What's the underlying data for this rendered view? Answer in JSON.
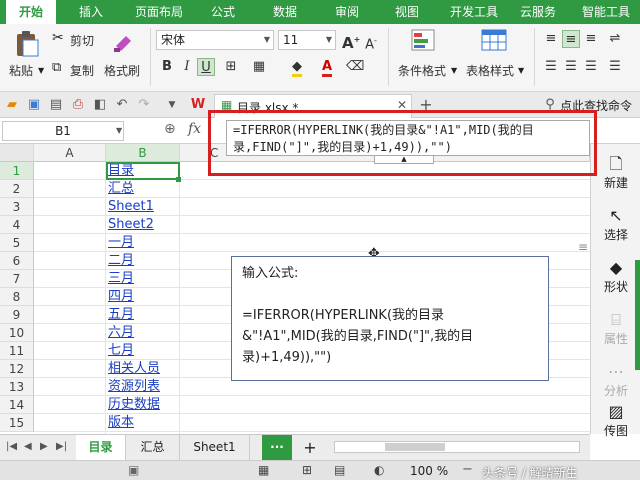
{
  "ribbon_tabs": [
    "开始",
    "插入",
    "页面布局",
    "公式",
    "数据",
    "审阅",
    "视图",
    "开发工具",
    "云服务",
    "智能工具"
  ],
  "active_tab": "开始",
  "ribbon": {
    "paste": "粘贴",
    "cut": "剪切",
    "copy": "复制",
    "format_painter": "格式刷",
    "font_name": "宋体",
    "font_size": "11",
    "conditional_format": "条件格式",
    "table_style": "表格样式"
  },
  "quick_access": {
    "doc_tab": "目录.xlsx *",
    "search_command": "点此查找命令"
  },
  "formula_bar": {
    "name_box": "B1",
    "fx_label": "fx",
    "formula_line1": "=IFERROR(HYPERLINK(我的目录&\"!A1\",MID(我的目",
    "formula_line2": "录,FIND(\"]\",我的目录)+1,49)),\"\")"
  },
  "columns": [
    "A",
    "B",
    "C"
  ],
  "rows": [
    {
      "num": "1",
      "b": "目录"
    },
    {
      "num": "2",
      "b": "汇总"
    },
    {
      "num": "3",
      "b": "Sheet1"
    },
    {
      "num": "4",
      "b": "Sheet2"
    },
    {
      "num": "5",
      "b": "一月"
    },
    {
      "num": "6",
      "b": "二月"
    },
    {
      "num": "7",
      "b": "三月"
    },
    {
      "num": "8",
      "b": "四月"
    },
    {
      "num": "9",
      "b": "五月"
    },
    {
      "num": "10",
      "b": "六月"
    },
    {
      "num": "11",
      "b": "七月"
    },
    {
      "num": "12",
      "b": "相关人员"
    },
    {
      "num": "13",
      "b": "资源列表"
    },
    {
      "num": "14",
      "b": "历史数据"
    },
    {
      "num": "15",
      "b": "版本"
    }
  ],
  "callout": {
    "heading": "输入公式:",
    "line1": "=IFERROR(HYPERLINK(我的目录",
    "line2": "&\"!A1\",MID(我的目录,FIND(\"]\",我的目",
    "line3": "录)+1,49)),\"\")"
  },
  "side_panel": [
    "新建",
    "选择",
    "形状",
    "属性",
    "分析",
    "传图"
  ],
  "sheet_tabs": [
    "目录",
    "汇总",
    "Sheet1"
  ],
  "active_sheet": "目录",
  "status": {
    "zoom": "100 %",
    "watermark": "头条号 / 解晴新生"
  },
  "colors": {
    "brand_green": "#2f9a42",
    "highlight_red": "#d62020",
    "link_blue": "#1a3ec2"
  }
}
